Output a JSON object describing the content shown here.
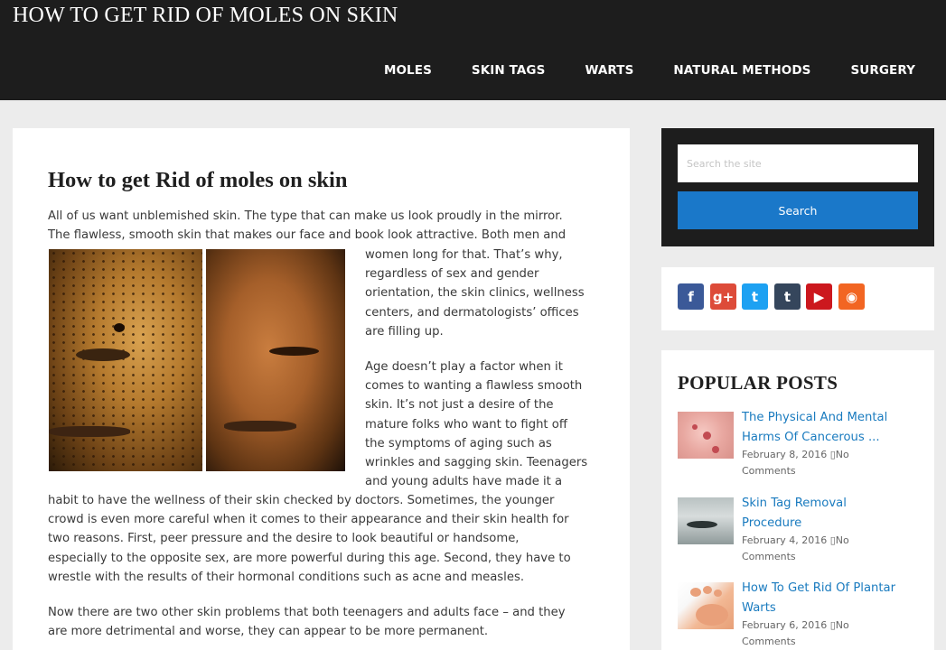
{
  "site": {
    "title": "HOW TO GET RID OF MOLES ON SKIN"
  },
  "nav": {
    "items": [
      "MOLES",
      "SKIN TAGS",
      "WARTS",
      "NATURAL METHODS",
      "SURGERY"
    ]
  },
  "article": {
    "title": "How to get Rid of moles on skin",
    "intro_line1": "All of us want unblemished skin. The type that can make us look proudly in the mirror.",
    "intro_line2": "The flawless, smooth skin that makes our face and book look attractive. Both men and",
    "float_lines": [
      "women long for that. That’s why,",
      "regardless of sex and gender",
      "orientation, the skin clinics, wellness",
      "centers, and dermatologists’ offices",
      "are filling up."
    ],
    "age_lines": [
      "Age doesn’t play a factor when it",
      "comes to wanting a flawless smooth",
      "skin. It’s not just a desire of the",
      "mature folks who want to fight off",
      "the symptoms of aging such as",
      "wrinkles and sagging skin. Teenagers",
      "and young adults have made it a"
    ],
    "cont_lines": [
      "habit to have the wellness of their skin checked by doctors. Sometimes, the younger",
      "crowd is even more careful when it comes to their appearance and their skin health for",
      "two reasons. First, peer pressure and the desire to look beautiful or handsome,",
      "especially to the opposite sex, are more powerful during this age. Second, they have to",
      "wrestle with the results of their hormonal conditions such as acne and measles."
    ],
    "now_lines": [
      "Now there are two other skin problems that both teenagers and adults face – and they",
      "are more detrimental and worse, they can appear to be more permanent."
    ]
  },
  "sidebar": {
    "search": {
      "placeholder": "Search the site",
      "button": "Search"
    },
    "social": [
      {
        "name": "facebook-icon",
        "glyph": "f",
        "color": "#3b5998"
      },
      {
        "name": "google-plus-icon",
        "glyph": "g+",
        "color": "#dd4b39"
      },
      {
        "name": "twitter-icon",
        "glyph": "t",
        "color": "#1da1f2"
      },
      {
        "name": "tumblr-icon",
        "glyph": "t",
        "color": "#35465c"
      },
      {
        "name": "youtube-icon",
        "glyph": "▶",
        "color": "#cc181e"
      },
      {
        "name": "rss-icon",
        "glyph": "◉",
        "color": "#f26522"
      }
    ],
    "popular": {
      "title": "POPULAR POSTS",
      "posts": [
        {
          "title_lines": [
            "The Physical And Mental",
            "Harms Of Cancerous ..."
          ],
          "date": "February 8, 2016",
          "comments_lines": [
            "No",
            "Comments"
          ]
        },
        {
          "title_lines": [
            "Skin Tag Removal",
            "Procedure"
          ],
          "date": "February 4, 2016",
          "comments_lines": [
            "No",
            "Comments"
          ]
        },
        {
          "title_lines": [
            "How To Get Rid Of Plantar",
            "Warts"
          ],
          "date": "February 6, 2016",
          "comments_lines": [
            "No",
            "Comments"
          ]
        }
      ]
    }
  }
}
